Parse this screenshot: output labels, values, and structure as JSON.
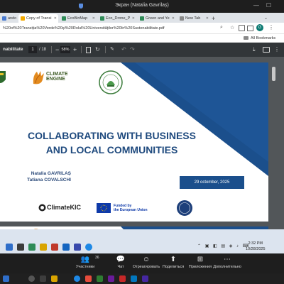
{
  "meeting": {
    "title": "Экран (Natalia Gavrilaș)",
    "controls": [
      {
        "label": "Участники",
        "icon": "participants-icon",
        "glyph": "👥",
        "count": "36"
      },
      {
        "label": "Чат",
        "icon": "chat-icon",
        "glyph": "💬"
      },
      {
        "label": "Отреагировать",
        "icon": "react-icon",
        "glyph": "☺"
      },
      {
        "label": "Поделиться",
        "icon": "share-icon",
        "glyph": "⬆"
      },
      {
        "label": "Приложения",
        "icon": "apps-icon",
        "glyph": "⊞"
      },
      {
        "label": "Дополнительно",
        "icon": "more-icon",
        "glyph": "⋯"
      }
    ]
  },
  "browser": {
    "tabs": [
      {
        "label": "ando",
        "color": "#4a7bd0"
      },
      {
        "label": "Copy of Transi",
        "color": "#f2a900"
      },
      {
        "label": "EcoBinMap",
        "color": "#2e8b57"
      },
      {
        "label": "Eco_Drone_P",
        "color": "#2e8b57"
      },
      {
        "label": "Green and Ye",
        "color": "#2e8b57"
      },
      {
        "label": "New Tab",
        "color": "#888888"
      }
    ],
    "new_tab": "+",
    "url": "%20of%20Tranziția%20Verde%20și%20Rolul%20Universităților%20în%20Sustenabilitate.pdf",
    "profile_initial": "G",
    "all_bookmarks": "All Bookmarks",
    "pdf": {
      "title": "nabilitate",
      "page_current": "1",
      "page_total": "/ 18",
      "zoom": "58%"
    }
  },
  "slide": {
    "logo_text": "CLIMATE\nENGINE",
    "title_line1": "COLLABORATING WITH BUSINESS",
    "title_line2": "AND LOCAL COMMUNITIES",
    "author1": "Natalia GAVRILAȘ",
    "author2": "Tatiana COVALSCHI",
    "date": "29 octomber, 2025",
    "partner1": "ClimateKIC",
    "partner2_line1": "Funded by",
    "partner2_line2": "the European Union"
  },
  "screen_clock": {
    "time": "2:32 PM",
    "date": "10/28/2025"
  },
  "colors": {
    "slide_blue": "#1b4f8c",
    "title_blue": "#1f4a7e",
    "meeting_bg": "#1e1e1e"
  }
}
